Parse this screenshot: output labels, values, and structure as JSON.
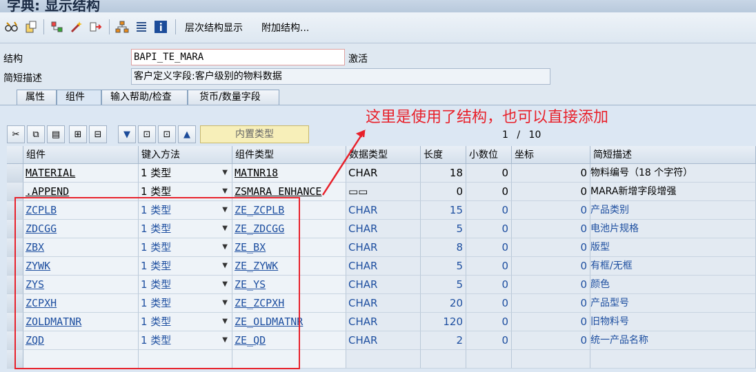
{
  "window": {
    "title": "字典: 显示结构"
  },
  "toolbar": {
    "icons": [
      "glasses-icon",
      "object-copy-icon",
      "hierarchy-icon",
      "magic-wand-icon",
      "transport-icon",
      "org-tree-icon",
      "list-icon",
      "info-icon"
    ],
    "hierarchy_display": "层次结构显示",
    "append_structure": "附加结构..."
  },
  "header": {
    "structure_label": "结构",
    "structure_value": "BAPI_TE_MARA",
    "status": "激活",
    "short_desc_label": "简短描述",
    "short_desc_value": "客户定义字段:客户级别的物料数据"
  },
  "tabs": [
    {
      "label": "属性"
    },
    {
      "label": "组件"
    },
    {
      "label": "输入帮助/检查"
    },
    {
      "label": "货币/数量字段"
    }
  ],
  "annotation": {
    "text": "这里是使用了结构，也可以直接添加"
  },
  "table_tools": {
    "builtin_type": "内置类型"
  },
  "pager": {
    "current": "1",
    "sep": "/",
    "total": "10"
  },
  "columns": {
    "component": "组件",
    "method": "键入方法",
    "comp_type": "组件类型",
    "data_type": "数据类型",
    "length": "长度",
    "decimals": "小数位",
    "coord": "坐标",
    "desc": "简短描述"
  },
  "rows": [
    {
      "component": "MATERIAL",
      "method": "1 类型",
      "comp_type": "MATNR18",
      "data_type": "CHAR",
      "length": "18",
      "decimals": "0",
      "coord": "0",
      "desc": "物料编号（18 个字符）",
      "blue": false
    },
    {
      "component": ".APPEND",
      "method": "1 类型",
      "comp_type": "ZSMARA_ENHANCE",
      "data_type": "▭▭",
      "length": "0",
      "decimals": "0",
      "coord": "0",
      "desc": "MARA新增字段增强",
      "blue": false
    },
    {
      "component": "ZCPLB",
      "method": "1 类型",
      "comp_type": "ZE_ZCPLB",
      "data_type": "CHAR",
      "length": "15",
      "decimals": "0",
      "coord": "0",
      "desc": "产品类别",
      "blue": true
    },
    {
      "component": "ZDCGG",
      "method": "1 类型",
      "comp_type": "ZE_ZDCGG",
      "data_type": "CHAR",
      "length": "5",
      "decimals": "0",
      "coord": "0",
      "desc": "电池片规格",
      "blue": true
    },
    {
      "component": "ZBX",
      "method": "1 类型",
      "comp_type": "ZE_BX",
      "data_type": "CHAR",
      "length": "8",
      "decimals": "0",
      "coord": "0",
      "desc": "版型",
      "blue": true
    },
    {
      "component": "ZYWK",
      "method": "1 类型",
      "comp_type": "ZE_ZYWK",
      "data_type": "CHAR",
      "length": "5",
      "decimals": "0",
      "coord": "0",
      "desc": "有框/无框",
      "blue": true
    },
    {
      "component": "ZYS",
      "method": "1 类型",
      "comp_type": "ZE_YS",
      "data_type": "CHAR",
      "length": "5",
      "decimals": "0",
      "coord": "0",
      "desc": "颜色",
      "blue": true
    },
    {
      "component": "ZCPXH",
      "method": "1 类型",
      "comp_type": "ZE_ZCPXH",
      "data_type": "CHAR",
      "length": "20",
      "decimals": "0",
      "coord": "0",
      "desc": "产品型号",
      "blue": true
    },
    {
      "component": "ZOLDMATNR",
      "method": "1 类型",
      "comp_type": "ZE_OLDMATNR",
      "data_type": "CHAR",
      "length": "120",
      "decimals": "0",
      "coord": "0",
      "desc": "旧物料号",
      "blue": true
    },
    {
      "component": "ZQD",
      "method": "1 类型",
      "comp_type": "ZE_QD",
      "data_type": "CHAR",
      "length": "2",
      "decimals": "0",
      "coord": "0",
      "desc": "统一产品名称",
      "blue": true
    },
    {
      "component": "",
      "method": "",
      "comp_type": "",
      "data_type": "",
      "length": "",
      "decimals": "",
      "coord": "",
      "desc": "",
      "blue": false
    }
  ],
  "colors": {
    "accent": "#e8202a",
    "link": "#1e4fa0"
  }
}
